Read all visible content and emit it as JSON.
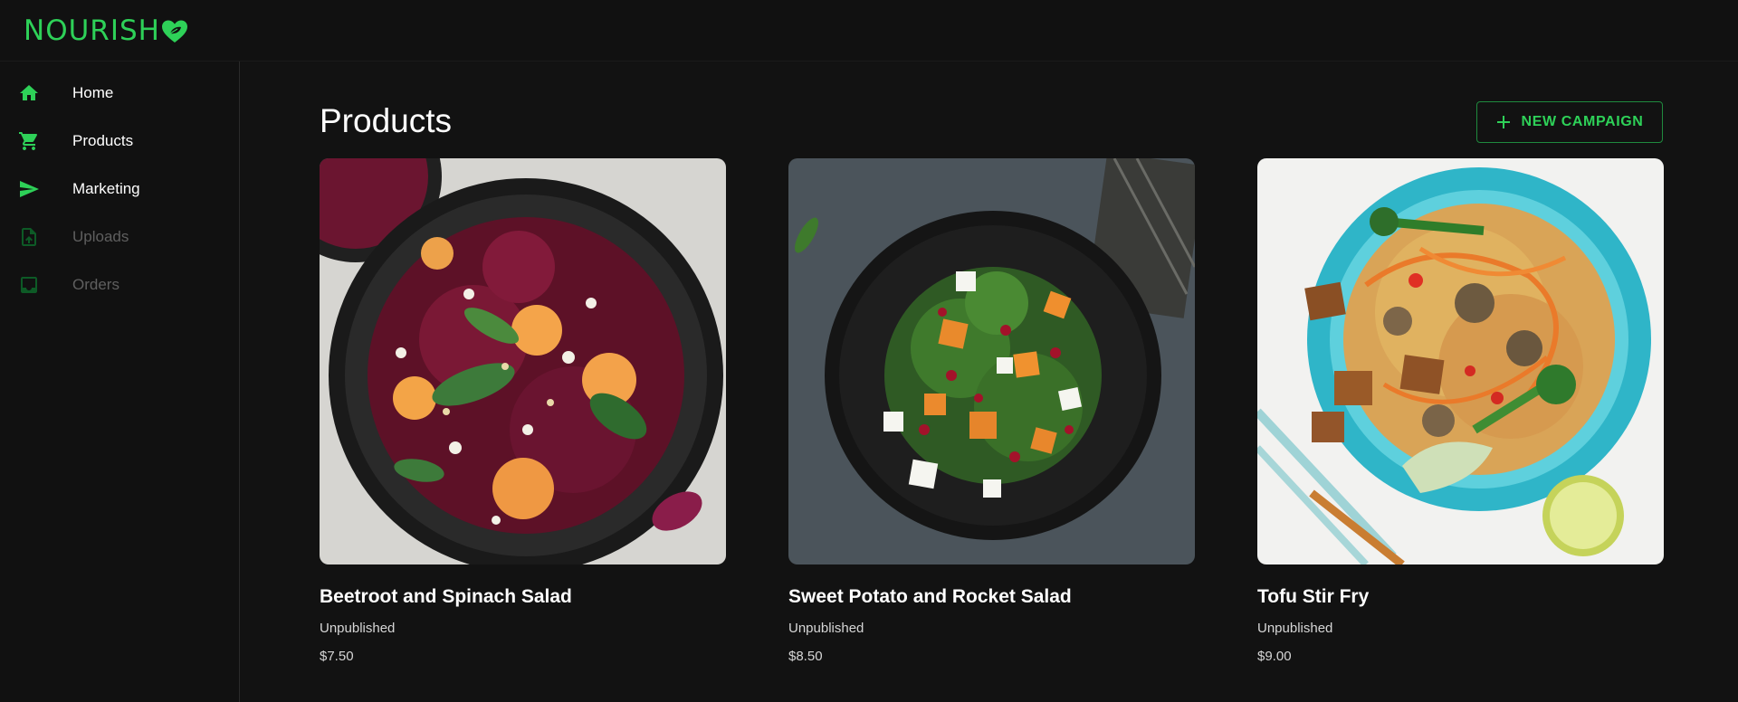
{
  "brand": {
    "name": "NOURISH",
    "accent": "#2ed158"
  },
  "sidebar": {
    "items": [
      {
        "label": "Home",
        "icon": "home-icon",
        "enabled": true
      },
      {
        "label": "Products",
        "icon": "cart-icon",
        "enabled": true
      },
      {
        "label": "Marketing",
        "icon": "send-icon",
        "enabled": true
      },
      {
        "label": "Uploads",
        "icon": "upload-file-icon",
        "enabled": false
      },
      {
        "label": "Orders",
        "icon": "inbox-icon",
        "enabled": false
      }
    ]
  },
  "main": {
    "title": "Products",
    "new_campaign_label": "NEW CAMPAIGN",
    "products": [
      {
        "name": "Beetroot and Spinach Salad",
        "status": "Unpublished",
        "price": "$7.50"
      },
      {
        "name": "Sweet Potato and Rocket Salad",
        "status": "Unpublished",
        "price": "$8.50"
      },
      {
        "name": "Tofu Stir Fry",
        "status": "Unpublished",
        "price": "$9.00"
      }
    ]
  }
}
